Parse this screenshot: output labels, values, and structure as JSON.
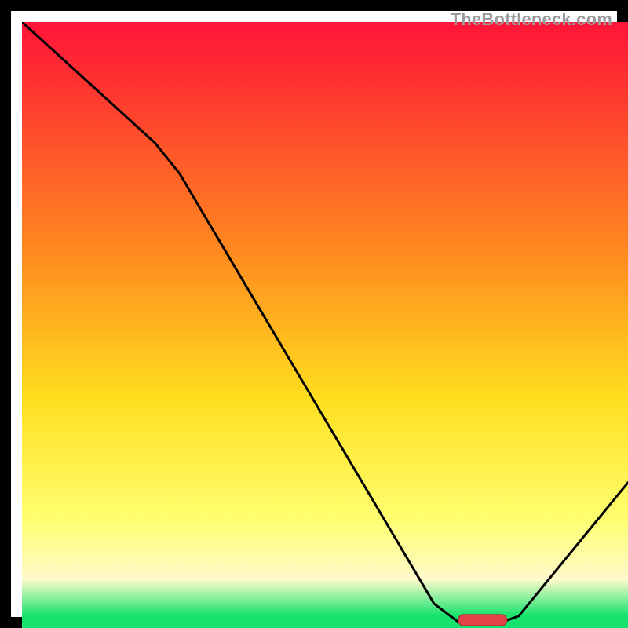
{
  "watermark": "TheBottleneck.com",
  "colors": {
    "border": "#000000",
    "curve": "#000000",
    "marker_fill": "#e2444a",
    "marker_border": "#b73137",
    "grad_top": "#ff1438",
    "grad_mid1": "#ff8a1f",
    "grad_mid2": "#ffde1e",
    "grad_low": "#fffacc",
    "grad_bottom": "#15e36c"
  },
  "chart_data": {
    "type": "line",
    "title": "",
    "xlabel": "",
    "ylabel": "",
    "x_range": [
      0,
      100
    ],
    "y_range": [
      0,
      100
    ],
    "gradient_stops": [
      {
        "offset": 0,
        "color": "#ff1438"
      },
      {
        "offset": 38,
        "color": "#ff8a1f"
      },
      {
        "offset": 62,
        "color": "#ffde1e"
      },
      {
        "offset": 82,
        "color": "#ffff70"
      },
      {
        "offset": 92,
        "color": "#fffacc"
      },
      {
        "offset": 98,
        "color": "#15e36c"
      },
      {
        "offset": 100,
        "color": "#15e36c"
      }
    ],
    "series": [
      {
        "name": "bottleneck-curve",
        "points": [
          {
            "x": 0,
            "y": 100
          },
          {
            "x": 22,
            "y": 80
          },
          {
            "x": 26,
            "y": 75
          },
          {
            "x": 68,
            "y": 4
          },
          {
            "x": 72,
            "y": 1
          },
          {
            "x": 78,
            "y": 0.5
          },
          {
            "x": 82,
            "y": 2
          },
          {
            "x": 100,
            "y": 24
          }
        ]
      }
    ],
    "marker": {
      "x_start": 72,
      "x_end": 80,
      "y": 1.3,
      "shape": "rounded-bar"
    }
  }
}
